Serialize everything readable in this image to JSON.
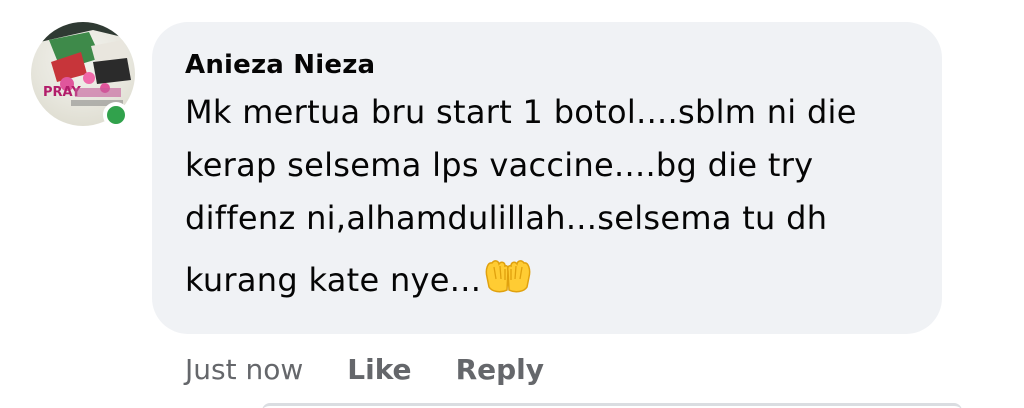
{
  "comment": {
    "author": "Anieza Nieza",
    "avatar_text": "PRAY",
    "lines": [
      "Mk mertua bru start 1 botol....sblm ni die",
      "kerap selsema lps vaccine....bg die try",
      "diffenz ni,alhamdulillah...selsema tu dh",
      "kurang kate nye..."
    ],
    "emoji_icon": "palms-up-together-icon",
    "online": true,
    "status_color": "#31a24c",
    "bubble_color": "#f0f2f5"
  },
  "actions": {
    "timestamp": "Just now",
    "like_label": "Like",
    "reply_label": "Reply"
  }
}
